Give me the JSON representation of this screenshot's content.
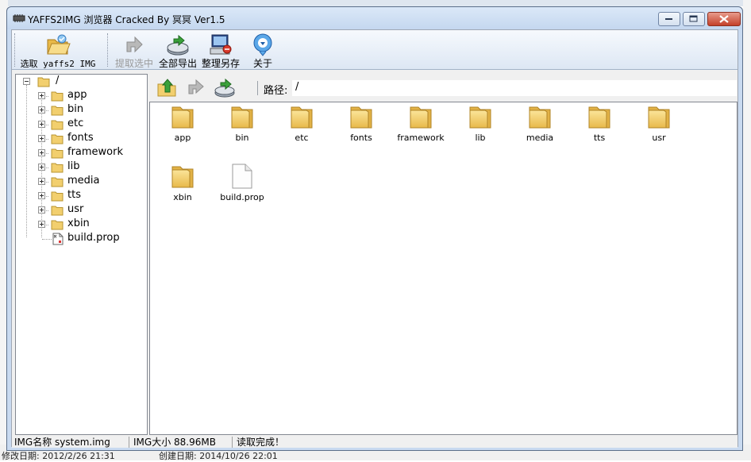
{
  "window": {
    "title": "YAFFS2IMG 浏览器 Cracked By 冥冥 Ver1.5"
  },
  "toolbar": {
    "select_label": "选取 yaffs2 IMG",
    "extract_label": "提取选中",
    "export_all_label": "全部导出",
    "organize_label": "整理另存",
    "about_label": "关于"
  },
  "tree": {
    "root": "/",
    "items": [
      {
        "label": "app",
        "type": "folder"
      },
      {
        "label": "bin",
        "type": "folder"
      },
      {
        "label": "etc",
        "type": "folder"
      },
      {
        "label": "fonts",
        "type": "folder"
      },
      {
        "label": "framework",
        "type": "folder"
      },
      {
        "label": "lib",
        "type": "folder"
      },
      {
        "label": "media",
        "type": "folder"
      },
      {
        "label": "tts",
        "type": "folder"
      },
      {
        "label": "usr",
        "type": "folder"
      },
      {
        "label": "xbin",
        "type": "folder"
      },
      {
        "label": "build.prop",
        "type": "file"
      }
    ]
  },
  "pathbar": {
    "label": "路径:",
    "value": "/"
  },
  "files": [
    {
      "name": "app",
      "type": "folder"
    },
    {
      "name": "bin",
      "type": "folder"
    },
    {
      "name": "etc",
      "type": "folder"
    },
    {
      "name": "fonts",
      "type": "folder"
    },
    {
      "name": "framework",
      "type": "folder"
    },
    {
      "name": "lib",
      "type": "folder"
    },
    {
      "name": "media",
      "type": "folder"
    },
    {
      "name": "tts",
      "type": "folder"
    },
    {
      "name": "usr",
      "type": "folder"
    },
    {
      "name": "xbin",
      "type": "folder"
    },
    {
      "name": "build.prop",
      "type": "file"
    }
  ],
  "status": {
    "img_name": "IMG名称 system.img",
    "img_size": "IMG大小 88.96MB",
    "message": "读取完成！"
  },
  "background": {
    "left_text": "修改日期: 2012/2/26 21:31",
    "right_text": "创建日期: 2014/10/26 22:01"
  },
  "colors": {
    "folder": "#f2cf6e",
    "title_bar": "#c4d7ef",
    "close_button": "#c4402a"
  }
}
